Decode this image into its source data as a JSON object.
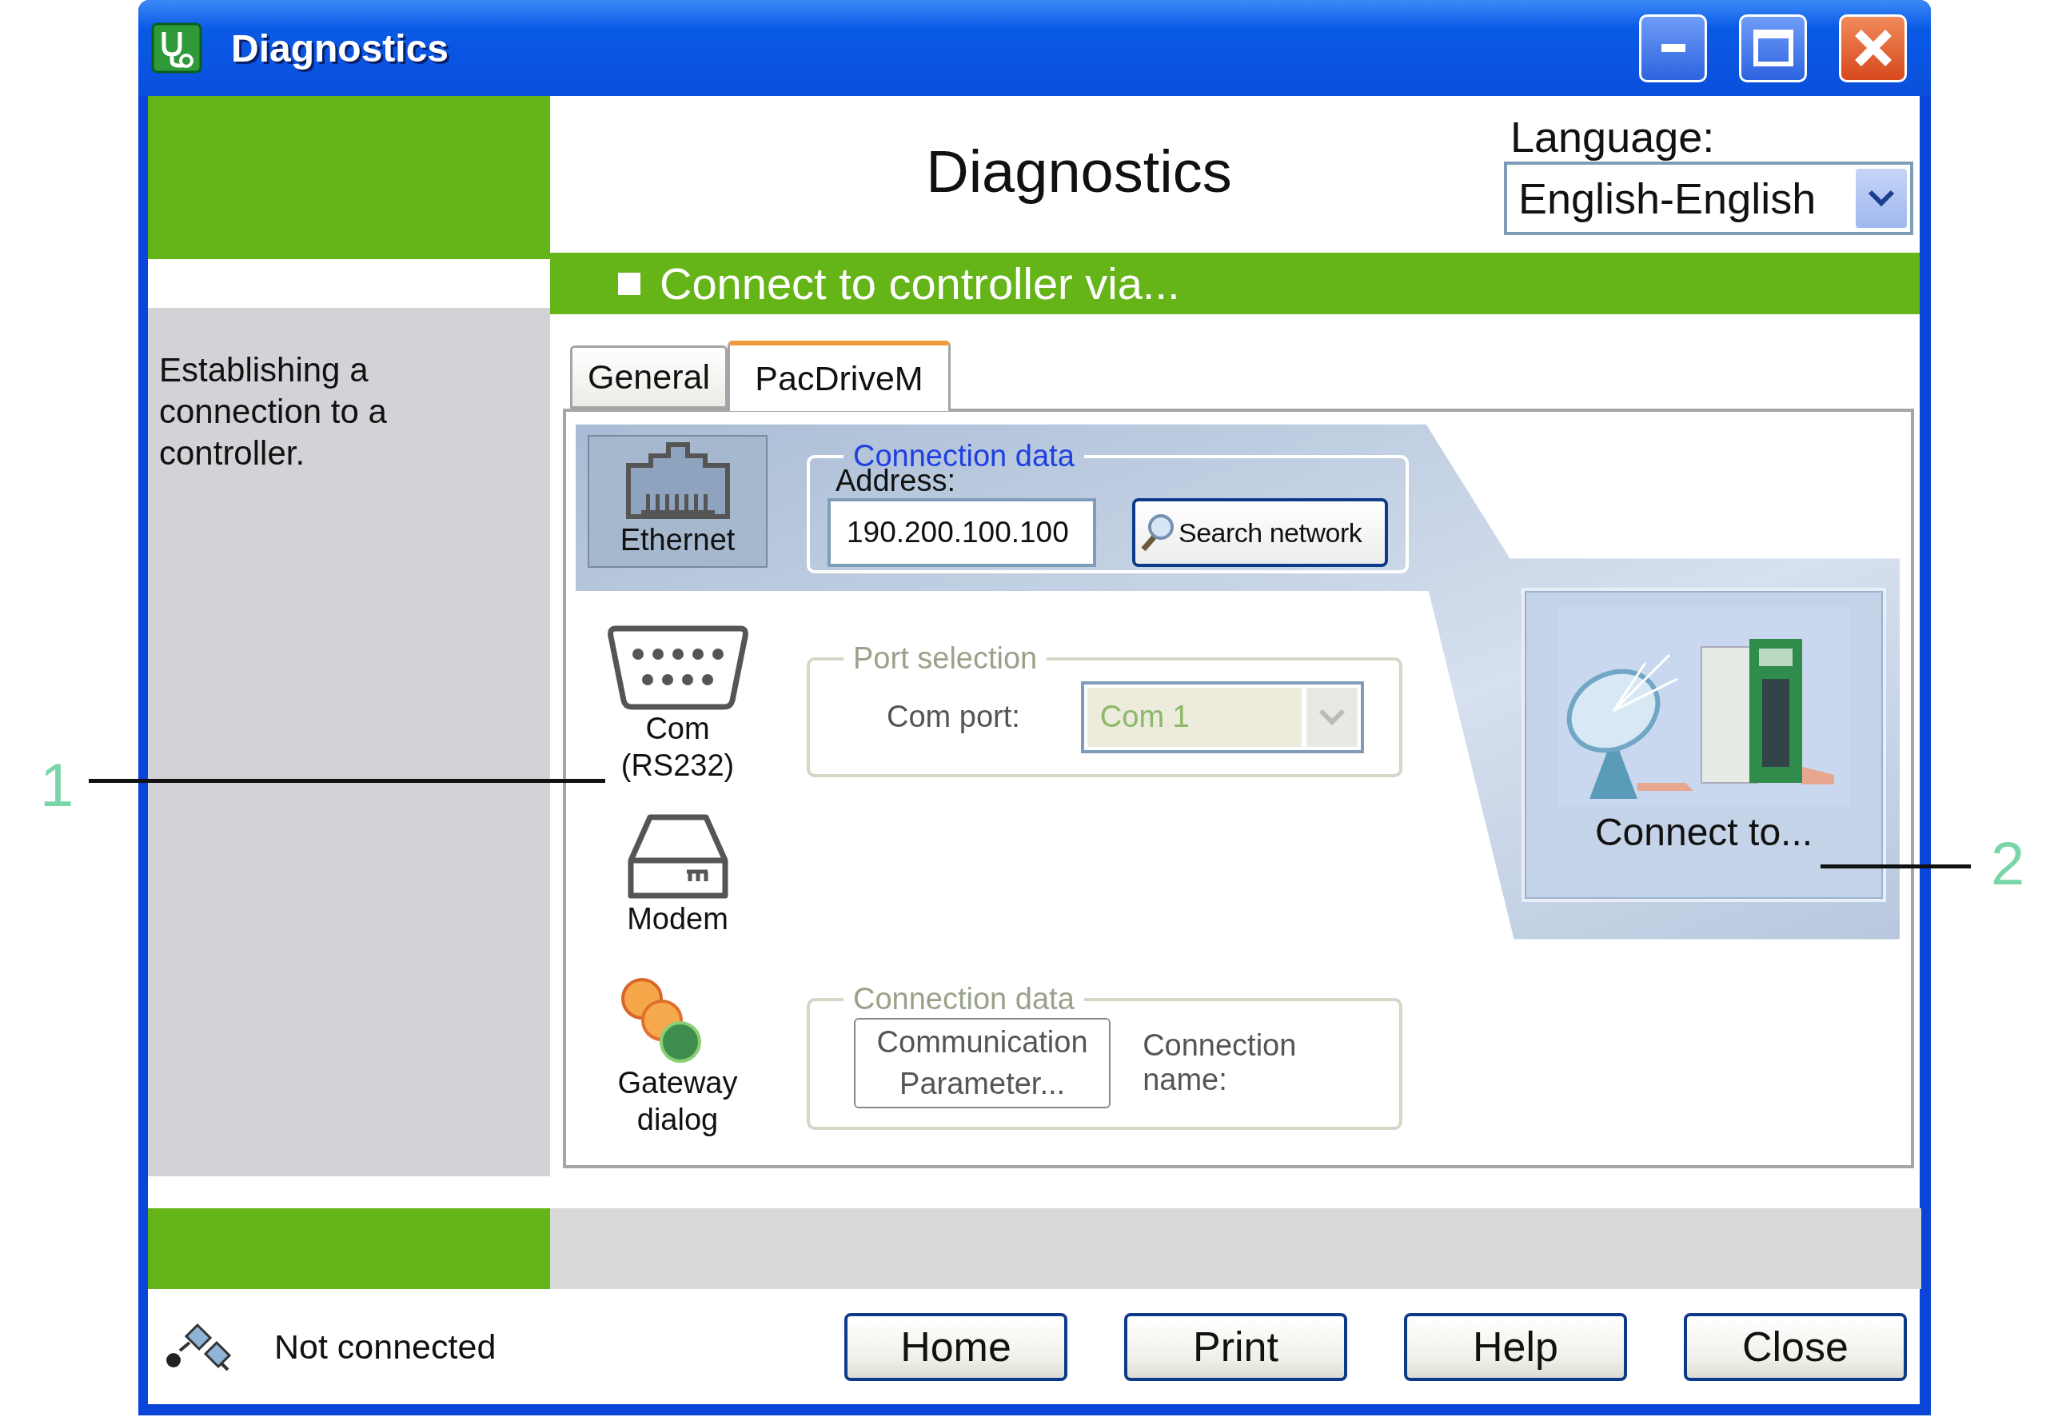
{
  "window": {
    "title": "Diagnostics"
  },
  "header": {
    "title": "Diagnostics",
    "language_label": "Language:",
    "language": "English-English"
  },
  "section_heading": "Connect to controller via...",
  "sidebar": {
    "text": "Establishing a connection to a controller."
  },
  "tabs": [
    {
      "label": "General",
      "selected": false
    },
    {
      "label": "PacDriveM",
      "selected": true
    }
  ],
  "connection_types": [
    {
      "kind": "ethernet",
      "label": "Ethernet",
      "selected": true
    },
    {
      "kind": "serial",
      "label": "Com (RS232)",
      "selected": false
    },
    {
      "kind": "modem",
      "label": "Modem",
      "selected": false
    },
    {
      "kind": "gateway",
      "label": "Gateway dialog",
      "selected": false
    }
  ],
  "ethernet_settings": {
    "legend": "Connection data",
    "disabled": false,
    "address_label": "Address:",
    "address": "190.200.100.100",
    "search_button": "Search network"
  },
  "port_selection": {
    "legend": "Port selection",
    "disabled": true,
    "com_port_label": "Com port:",
    "com_port": "Com 1"
  },
  "gateway_settings": {
    "legend": "Connection data",
    "disabled": true,
    "parameters_button": "Communication Parameter...",
    "connection_name_label": "Connection name:"
  },
  "connect_button": "Connect to...",
  "status": {
    "text": "Not connected"
  },
  "buttons": [
    "Home",
    "Print",
    "Help",
    "Close"
  ],
  "callouts": [
    {
      "label": "1"
    },
    {
      "label": "2"
    }
  ]
}
